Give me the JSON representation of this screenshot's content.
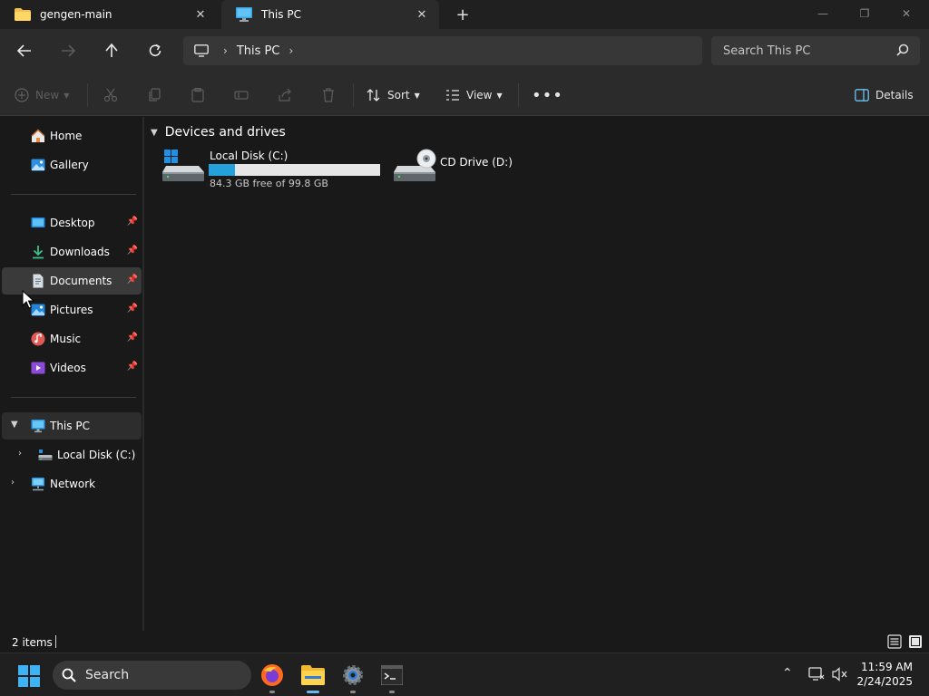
{
  "tabs": [
    {
      "label": "gengen-main",
      "icon": "folder-icon",
      "active": false
    },
    {
      "label": "This PC",
      "icon": "monitor-icon",
      "active": true
    }
  ],
  "window_controls": {
    "minimize": "—",
    "maximize": "❐",
    "close": "✕"
  },
  "address": {
    "segments": [
      "This PC"
    ],
    "search_placeholder": "Search This PC"
  },
  "toolbar": {
    "new_label": "New",
    "sort_label": "Sort",
    "view_label": "View",
    "details_label": "Details"
  },
  "sidebar": {
    "quick": [
      {
        "label": "Home",
        "icon": "home-icon"
      },
      {
        "label": "Gallery",
        "icon": "gallery-icon"
      }
    ],
    "pinned": [
      {
        "label": "Desktop",
        "icon": "desktop-icon"
      },
      {
        "label": "Downloads",
        "icon": "downloads-icon"
      },
      {
        "label": "Documents",
        "icon": "documents-icon"
      },
      {
        "label": "Pictures",
        "icon": "pictures-icon"
      },
      {
        "label": "Music",
        "icon": "music-icon"
      },
      {
        "label": "Videos",
        "icon": "videos-icon"
      }
    ],
    "tree": [
      {
        "label": "This PC",
        "icon": "monitor-icon",
        "expanded": true
      },
      {
        "label": "Local Disk (C:)",
        "icon": "drive-icon",
        "expanded": false
      },
      {
        "label": "Network",
        "icon": "network-icon",
        "expanded": false
      }
    ]
  },
  "content": {
    "group_title": "Devices and drives",
    "drives": [
      {
        "name": "Local Disk (C:)",
        "free_text": "84.3 GB free of 99.8 GB",
        "used_fraction": 0.155
      },
      {
        "name": "CD Drive (D:)"
      }
    ]
  },
  "status": {
    "items_count": "2 items"
  },
  "taskbar": {
    "search_label": "Search",
    "time": "11:59 AM",
    "date": "2/24/2025"
  },
  "colors": {
    "accent": "#26a0da",
    "window_bg": "#191919",
    "toolbar_bg": "#2b2b2b"
  }
}
